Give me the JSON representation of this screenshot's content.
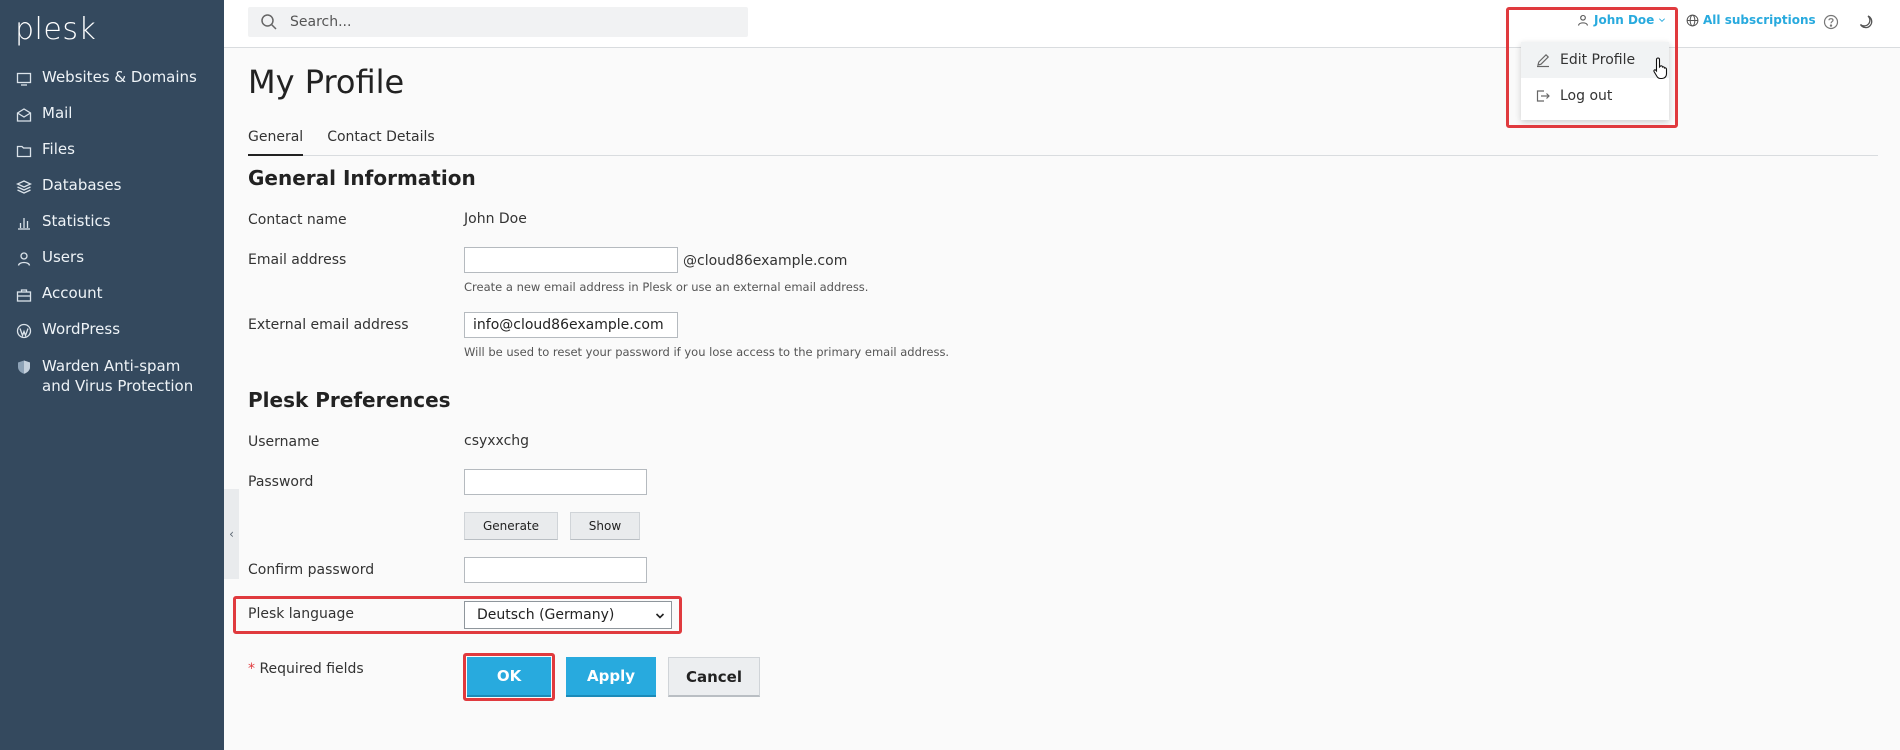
{
  "brand": {
    "logo_text": "plesk"
  },
  "sidebar": {
    "items": [
      {
        "label": "Websites & Domains",
        "icon": "monitor-icon"
      },
      {
        "label": "Mail",
        "icon": "mail-icon"
      },
      {
        "label": "Files",
        "icon": "folder-icon"
      },
      {
        "label": "Databases",
        "icon": "layers-icon"
      },
      {
        "label": "Statistics",
        "icon": "bar-chart-icon"
      },
      {
        "label": "Users",
        "icon": "user-icon"
      },
      {
        "label": "Account",
        "icon": "briefcase-icon"
      },
      {
        "label": "WordPress",
        "icon": "wordpress-icon"
      },
      {
        "label": "Warden Anti-spam and Virus Protection",
        "icon": "shield-icon"
      }
    ],
    "collapse_glyph": "‹"
  },
  "topbar": {
    "search_placeholder": "Search...",
    "user_name": "John Doe",
    "subscriptions_label": "All subscriptions"
  },
  "user_menu": {
    "items": [
      {
        "label": "Edit Profile",
        "icon": "pencil-icon"
      },
      {
        "label": "Log out",
        "icon": "logout-icon"
      }
    ]
  },
  "page": {
    "title": "My Profile",
    "tabs": [
      "General",
      "Contact Details"
    ],
    "active_tab": "General"
  },
  "general_info": {
    "title": "General Information",
    "contact_name_label": "Contact name",
    "contact_name_value": "John Doe",
    "email_label": "Email address",
    "email_value": "",
    "email_suffix": "@cloud86example.com",
    "email_hint": "Create a new email address in Plesk or use an external email address.",
    "external_email_label": "External email address",
    "external_email_value": "info@cloud86example.com",
    "external_email_hint": "Will be used to reset your password if you lose access to the primary email address."
  },
  "preferences": {
    "title": "Plesk Preferences",
    "username_label": "Username",
    "username_value": "csyxxchg",
    "password_label": "Password",
    "password_value": "",
    "generate_label": "Generate",
    "show_label": "Show",
    "confirm_password_label": "Confirm password",
    "confirm_password_value": "",
    "language_label": "Plesk language",
    "language_value": "Deutsch (Germany)"
  },
  "form": {
    "required_mark": "*",
    "required_label": "Required fields",
    "ok_label": "OK",
    "apply_label": "Apply",
    "cancel_label": "Cancel"
  },
  "colors": {
    "sidebar_bg": "#34495e",
    "accent": "#28aade",
    "highlight": "#e03a3e"
  }
}
